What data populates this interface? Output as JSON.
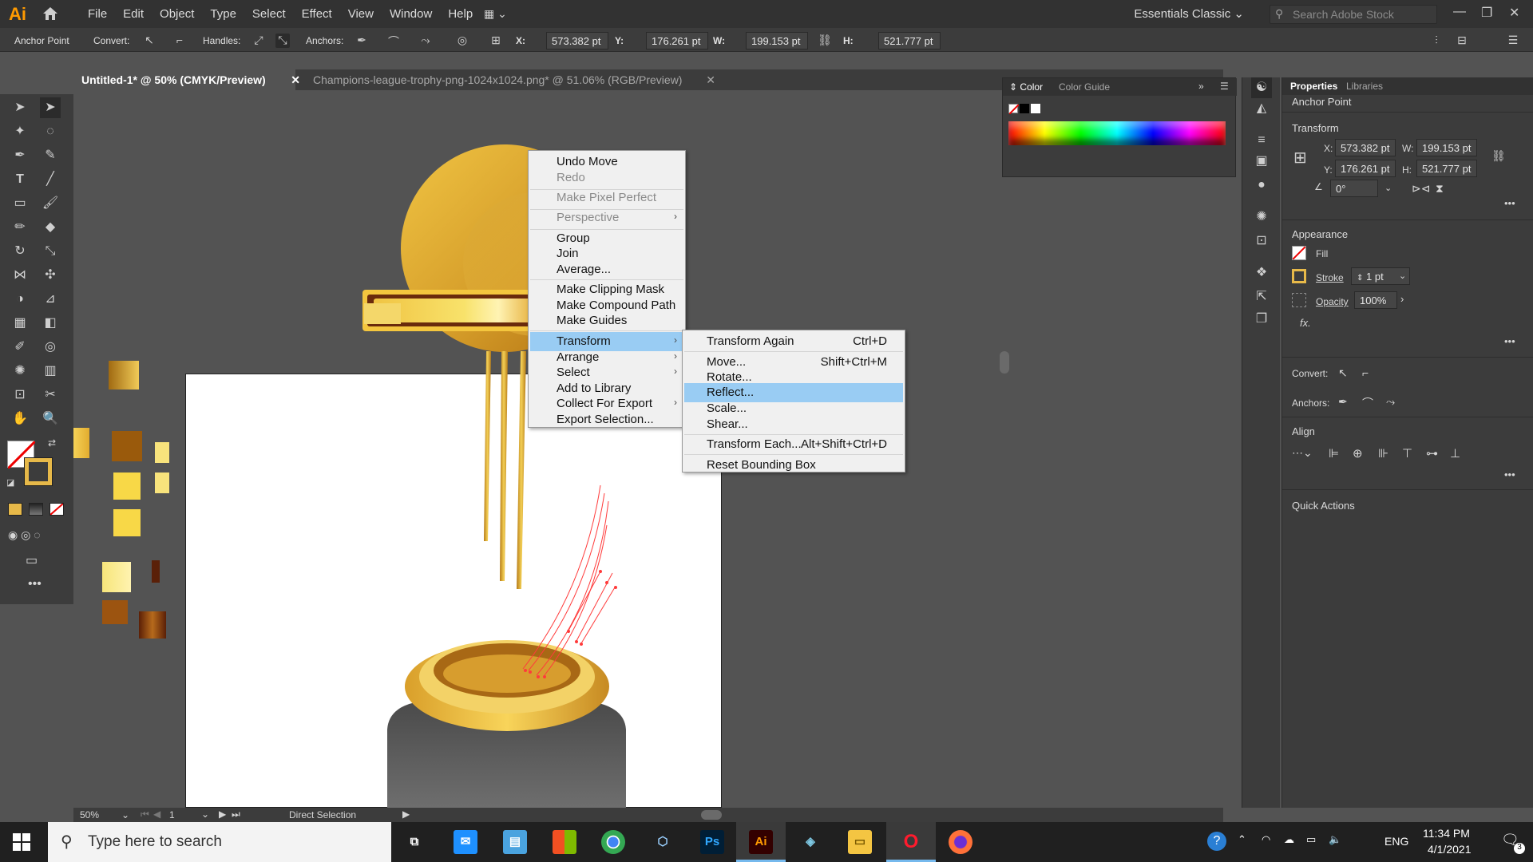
{
  "menubar": {
    "logo": "Ai",
    "items": [
      "File",
      "Edit",
      "Object",
      "Type",
      "Select",
      "Effect",
      "View",
      "Window",
      "Help"
    ],
    "workspace": "Essentials Classic",
    "search_placeholder": "Search Adobe Stock"
  },
  "control": {
    "tool_label": "Anchor Point",
    "convert_label": "Convert:",
    "handles_label": "Handles:",
    "anchors_label": "Anchors:",
    "x_label": "X:",
    "x_value": "573.382 pt",
    "y_label": "Y:",
    "y_value": "176.261 pt",
    "w_label": "W:",
    "w_value": "199.153 pt",
    "h_label": "H:",
    "h_value": "521.777 pt"
  },
  "tabs": [
    {
      "label": "Untitled-1* @ 50% (CMYK/Preview)",
      "active": true
    },
    {
      "label": "Champions-league-trophy-png-1024x1024.png* @ 51.06% (RGB/Preview)",
      "active": false
    }
  ],
  "context_menu": {
    "items": [
      {
        "label": "Undo Move",
        "enabled": true
      },
      {
        "label": "Redo",
        "enabled": false
      },
      {
        "label": "Make Pixel Perfect",
        "enabled": false
      },
      {
        "label": "Perspective",
        "enabled": false,
        "submenu": true
      },
      {
        "label": "Group",
        "enabled": true
      },
      {
        "label": "Join",
        "enabled": true
      },
      {
        "label": "Average...",
        "enabled": true
      },
      {
        "label": "Make Clipping Mask",
        "enabled": true
      },
      {
        "label": "Make Compound Path",
        "enabled": true
      },
      {
        "label": "Make Guides",
        "enabled": true
      },
      {
        "label": "Transform",
        "enabled": true,
        "submenu": true,
        "highlighted": true
      },
      {
        "label": "Arrange",
        "enabled": true,
        "submenu": true
      },
      {
        "label": "Select",
        "enabled": true,
        "submenu": true
      },
      {
        "label": "Add to Library",
        "enabled": true
      },
      {
        "label": "Collect For Export",
        "enabled": true,
        "submenu": true
      },
      {
        "label": "Export Selection...",
        "enabled": true
      }
    ]
  },
  "transform_submenu": {
    "items": [
      {
        "label": "Transform Again",
        "shortcut": "Ctrl+D"
      },
      {
        "label": "Move...",
        "shortcut": "Shift+Ctrl+M"
      },
      {
        "label": "Rotate...",
        "shortcut": ""
      },
      {
        "label": "Reflect...",
        "shortcut": "",
        "highlighted": true
      },
      {
        "label": "Scale...",
        "shortcut": ""
      },
      {
        "label": "Shear...",
        "shortcut": ""
      },
      {
        "label": "Transform Each...",
        "shortcut": "Alt+Shift+Ctrl+D"
      },
      {
        "label": "Reset Bounding Box",
        "shortcut": ""
      }
    ]
  },
  "color_panel": {
    "tab_color": "Color",
    "tab_guide": "Color Guide"
  },
  "properties": {
    "tab_properties": "Properties",
    "tab_libraries": "Libraries",
    "selection": "Anchor Point",
    "transform_title": "Transform",
    "x_label": "X:",
    "x": "573.382 pt",
    "y_label": "Y:",
    "y": "176.261 pt",
    "w_label": "W:",
    "w": "199.153 pt",
    "h_label": "H:",
    "h": "521.777 pt",
    "angle": "0°",
    "appearance_title": "Appearance",
    "fill_label": "Fill",
    "stroke_label": "Stroke",
    "stroke_value": "1 pt",
    "opacity_label": "Opacity",
    "opacity_value": "100%",
    "fx_label": "fx.",
    "convert_label": "Convert:",
    "anchors_label": "Anchors:",
    "align_title": "Align",
    "quick_actions_title": "Quick Actions"
  },
  "status": {
    "zoom": "50%",
    "artboard": "1",
    "tool": "Direct Selection"
  },
  "taskbar": {
    "search_placeholder": "Type here to search",
    "lang": "ENG",
    "time": "11:34 PM",
    "date": "4/1/2021",
    "notif_count": "3"
  },
  "colors": {
    "accent_highlight": "#99ccf3",
    "app_bg": "#535353",
    "panel_bg": "#3c3c3c",
    "gold_dark": "#a0670f",
    "gold_light": "#f7d75a"
  }
}
